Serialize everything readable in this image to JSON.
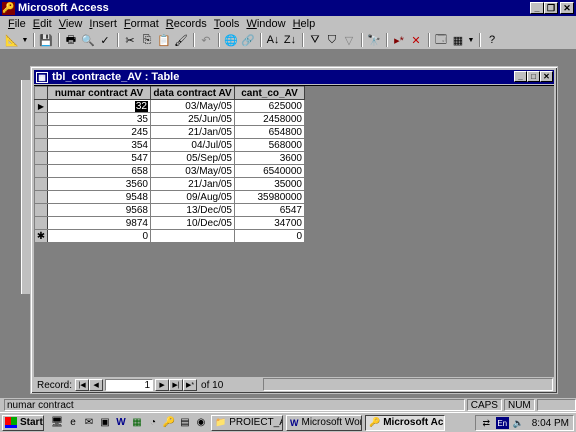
{
  "app": {
    "title": "Microsoft Access"
  },
  "menu": [
    "File",
    "Edit",
    "View",
    "Insert",
    "Format",
    "Records",
    "Tools",
    "Window",
    "Help"
  ],
  "table_window": {
    "title": "tbl_contracte_AV : Table"
  },
  "table": {
    "columns": [
      "numar contract AV",
      "data contract AV",
      "cant_co_AV"
    ],
    "rows": [
      [
        "32",
        "03/May/05",
        "625000"
      ],
      [
        "35",
        "25/Jun/05",
        "2458000"
      ],
      [
        "245",
        "21/Jan/05",
        "654800"
      ],
      [
        "354",
        "04/Jul/05",
        "568000"
      ],
      [
        "547",
        "05/Sep/05",
        "3600"
      ],
      [
        "658",
        "03/May/05",
        "6540000"
      ],
      [
        "3560",
        "21/Jan/05",
        "35000"
      ],
      [
        "9548",
        "09/Aug/05",
        "35980000"
      ],
      [
        "9568",
        "13/Dec/05",
        "6547"
      ],
      [
        "9874",
        "10/Dec/05",
        "34700"
      ]
    ],
    "new_row": [
      "0",
      "",
      "0"
    ]
  },
  "navigator": {
    "label": "Record:",
    "current": "1",
    "of_text": "of 10"
  },
  "status": {
    "text": "numar contract",
    "caps": "CAPS",
    "num": "NUM"
  },
  "taskbar": {
    "start": "Start",
    "tasks": [
      "PROIECT_AV",
      "Microsoft Word ...",
      "Microsoft Ac..."
    ],
    "clock": "8:04 PM",
    "lang": "En"
  }
}
